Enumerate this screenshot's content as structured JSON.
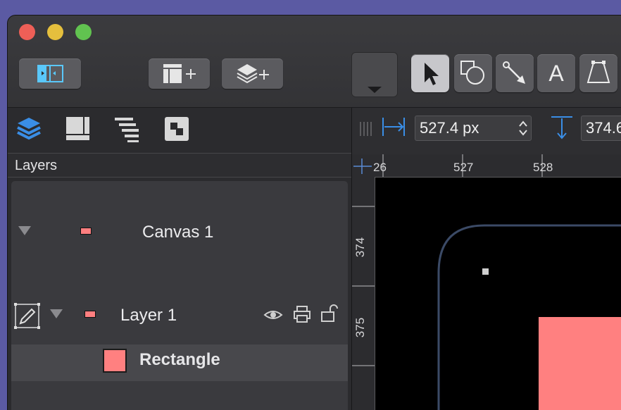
{
  "sidebar": {
    "header": "Layers",
    "tabs": [
      {
        "icon": "layers-stack-icon"
      },
      {
        "icon": "canvases-grid-icon"
      },
      {
        "icon": "outline-list-icon"
      },
      {
        "icon": "object-icon"
      }
    ],
    "canvas_row": {
      "label": "Canvas 1"
    },
    "layer_row": {
      "label": "Layer 1"
    },
    "object_row": {
      "label": "Rectangle",
      "swatch_color": "#ff8080"
    }
  },
  "inspector": {
    "x_value": "527.4 px",
    "y_value": "374.6"
  },
  "ruler": {
    "h_ticks": [
      "26",
      "527",
      "528"
    ],
    "v_ticks": [
      "374",
      "375"
    ]
  },
  "colors": {
    "accent_blue": "#3a8ee6",
    "shape_fill": "#ff8080",
    "selection_outline": "#3b4a66"
  }
}
